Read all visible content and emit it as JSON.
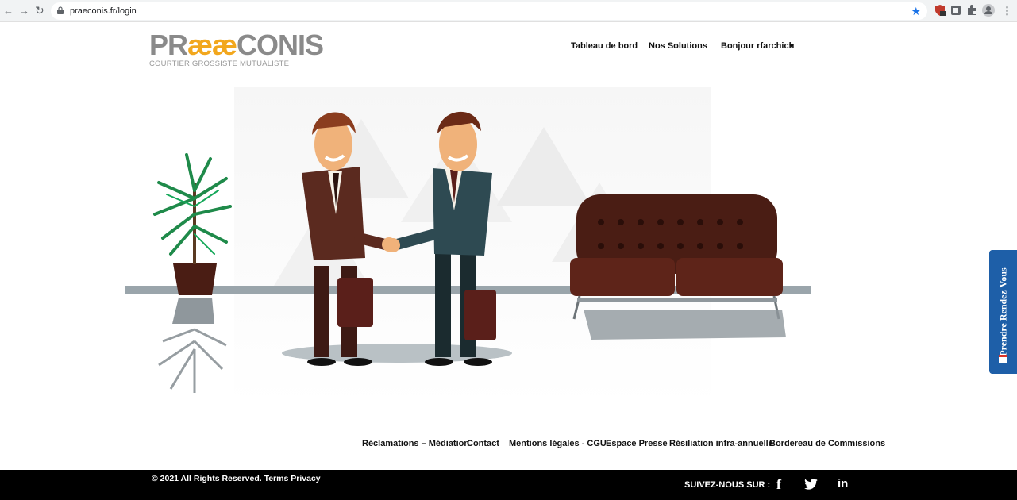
{
  "browser": {
    "back_icon": "arrow-left-icon",
    "forward_icon": "arrow-right-icon",
    "reload_icon": "reload-icon",
    "url": "praeconis.fr/login"
  },
  "logo": {
    "prefix": "PR",
    "ae": "ææ",
    "suffix": "CONIS",
    "tagline": "COURTIER GROSSISTE MUTUALISTE"
  },
  "nav": {
    "dashboard": "Tableau de bord",
    "solutions": "Nos Solutions",
    "user": "Bonjour rfarchich"
  },
  "side_tab": {
    "label": "Prendre Rendez-Vous"
  },
  "footer_links": [
    "Réclamations – Médiation",
    "Contact",
    "Mentions légales - CGU",
    "Espace Presse",
    "Résiliation infra-annuelle",
    "Bordereau de Commissions"
  ],
  "footer": {
    "copyright": "© 2021 All Rights Reserved. Terms Privacy",
    "follow": "SUIVEZ-NOUS SUR :",
    "facebook": "f",
    "linkedin": "in"
  },
  "colors": {
    "brand_orange": "#f2a71d",
    "side_tab_blue": "#1e5fa8"
  }
}
